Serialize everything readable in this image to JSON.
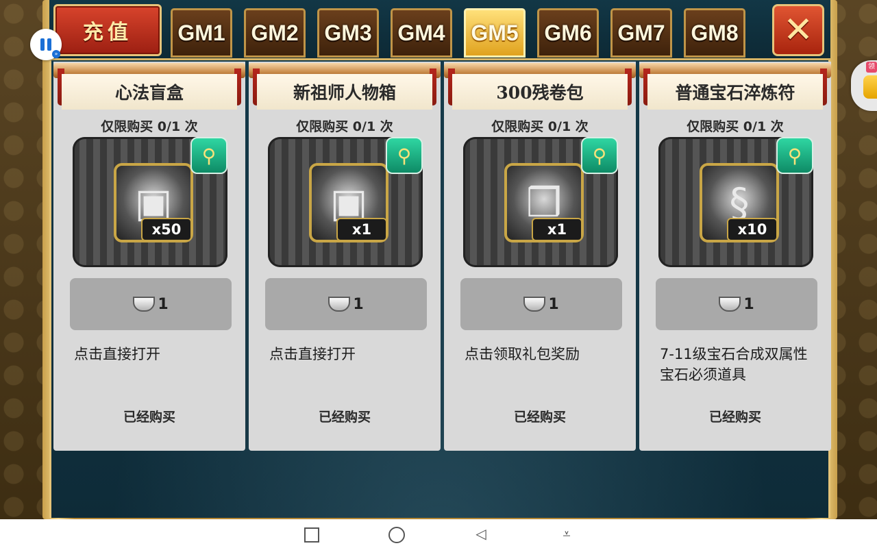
{
  "header": {
    "recharge_label": "充值",
    "tabs": [
      "GM1",
      "GM2",
      "GM3",
      "GM4",
      "GM5",
      "GM6",
      "GM7",
      "GM8"
    ],
    "active_tab": "GM5",
    "close_label": "✕"
  },
  "overlay": {
    "side_tag": "领"
  },
  "cards": [
    {
      "title": "心法盲盒",
      "limit": "仅限购买 0/1 次",
      "item_icon": "treasure-chest",
      "quantity": "x50",
      "price": "1",
      "description": "点击直接打开",
      "status": "已经购买"
    },
    {
      "title": "新祖师人物箱",
      "limit": "仅限购买 0/1 次",
      "item_icon": "treasure-chest",
      "quantity": "x1",
      "price": "1",
      "description": "点击直接打开",
      "status": "已经购买"
    },
    {
      "title": "300残卷包",
      "limit": "仅限购买 0/1 次",
      "item_icon": "gift-box",
      "quantity": "x1",
      "price": "1",
      "description": "点击领取礼包奖励",
      "status": "已经购买"
    },
    {
      "title": "普通宝石淬炼符",
      "limit": "仅限购买 0/1 次",
      "item_icon": "talisman",
      "quantity": "x10",
      "price": "1",
      "description": "7-11级宝石合成双属性宝石必须道具",
      "status": "已经购买"
    }
  ],
  "colors": {
    "panel": "#163c4c",
    "gold_border": "#e6c478",
    "active_tab": "#e0a21e",
    "card": "#d9d9d9"
  }
}
